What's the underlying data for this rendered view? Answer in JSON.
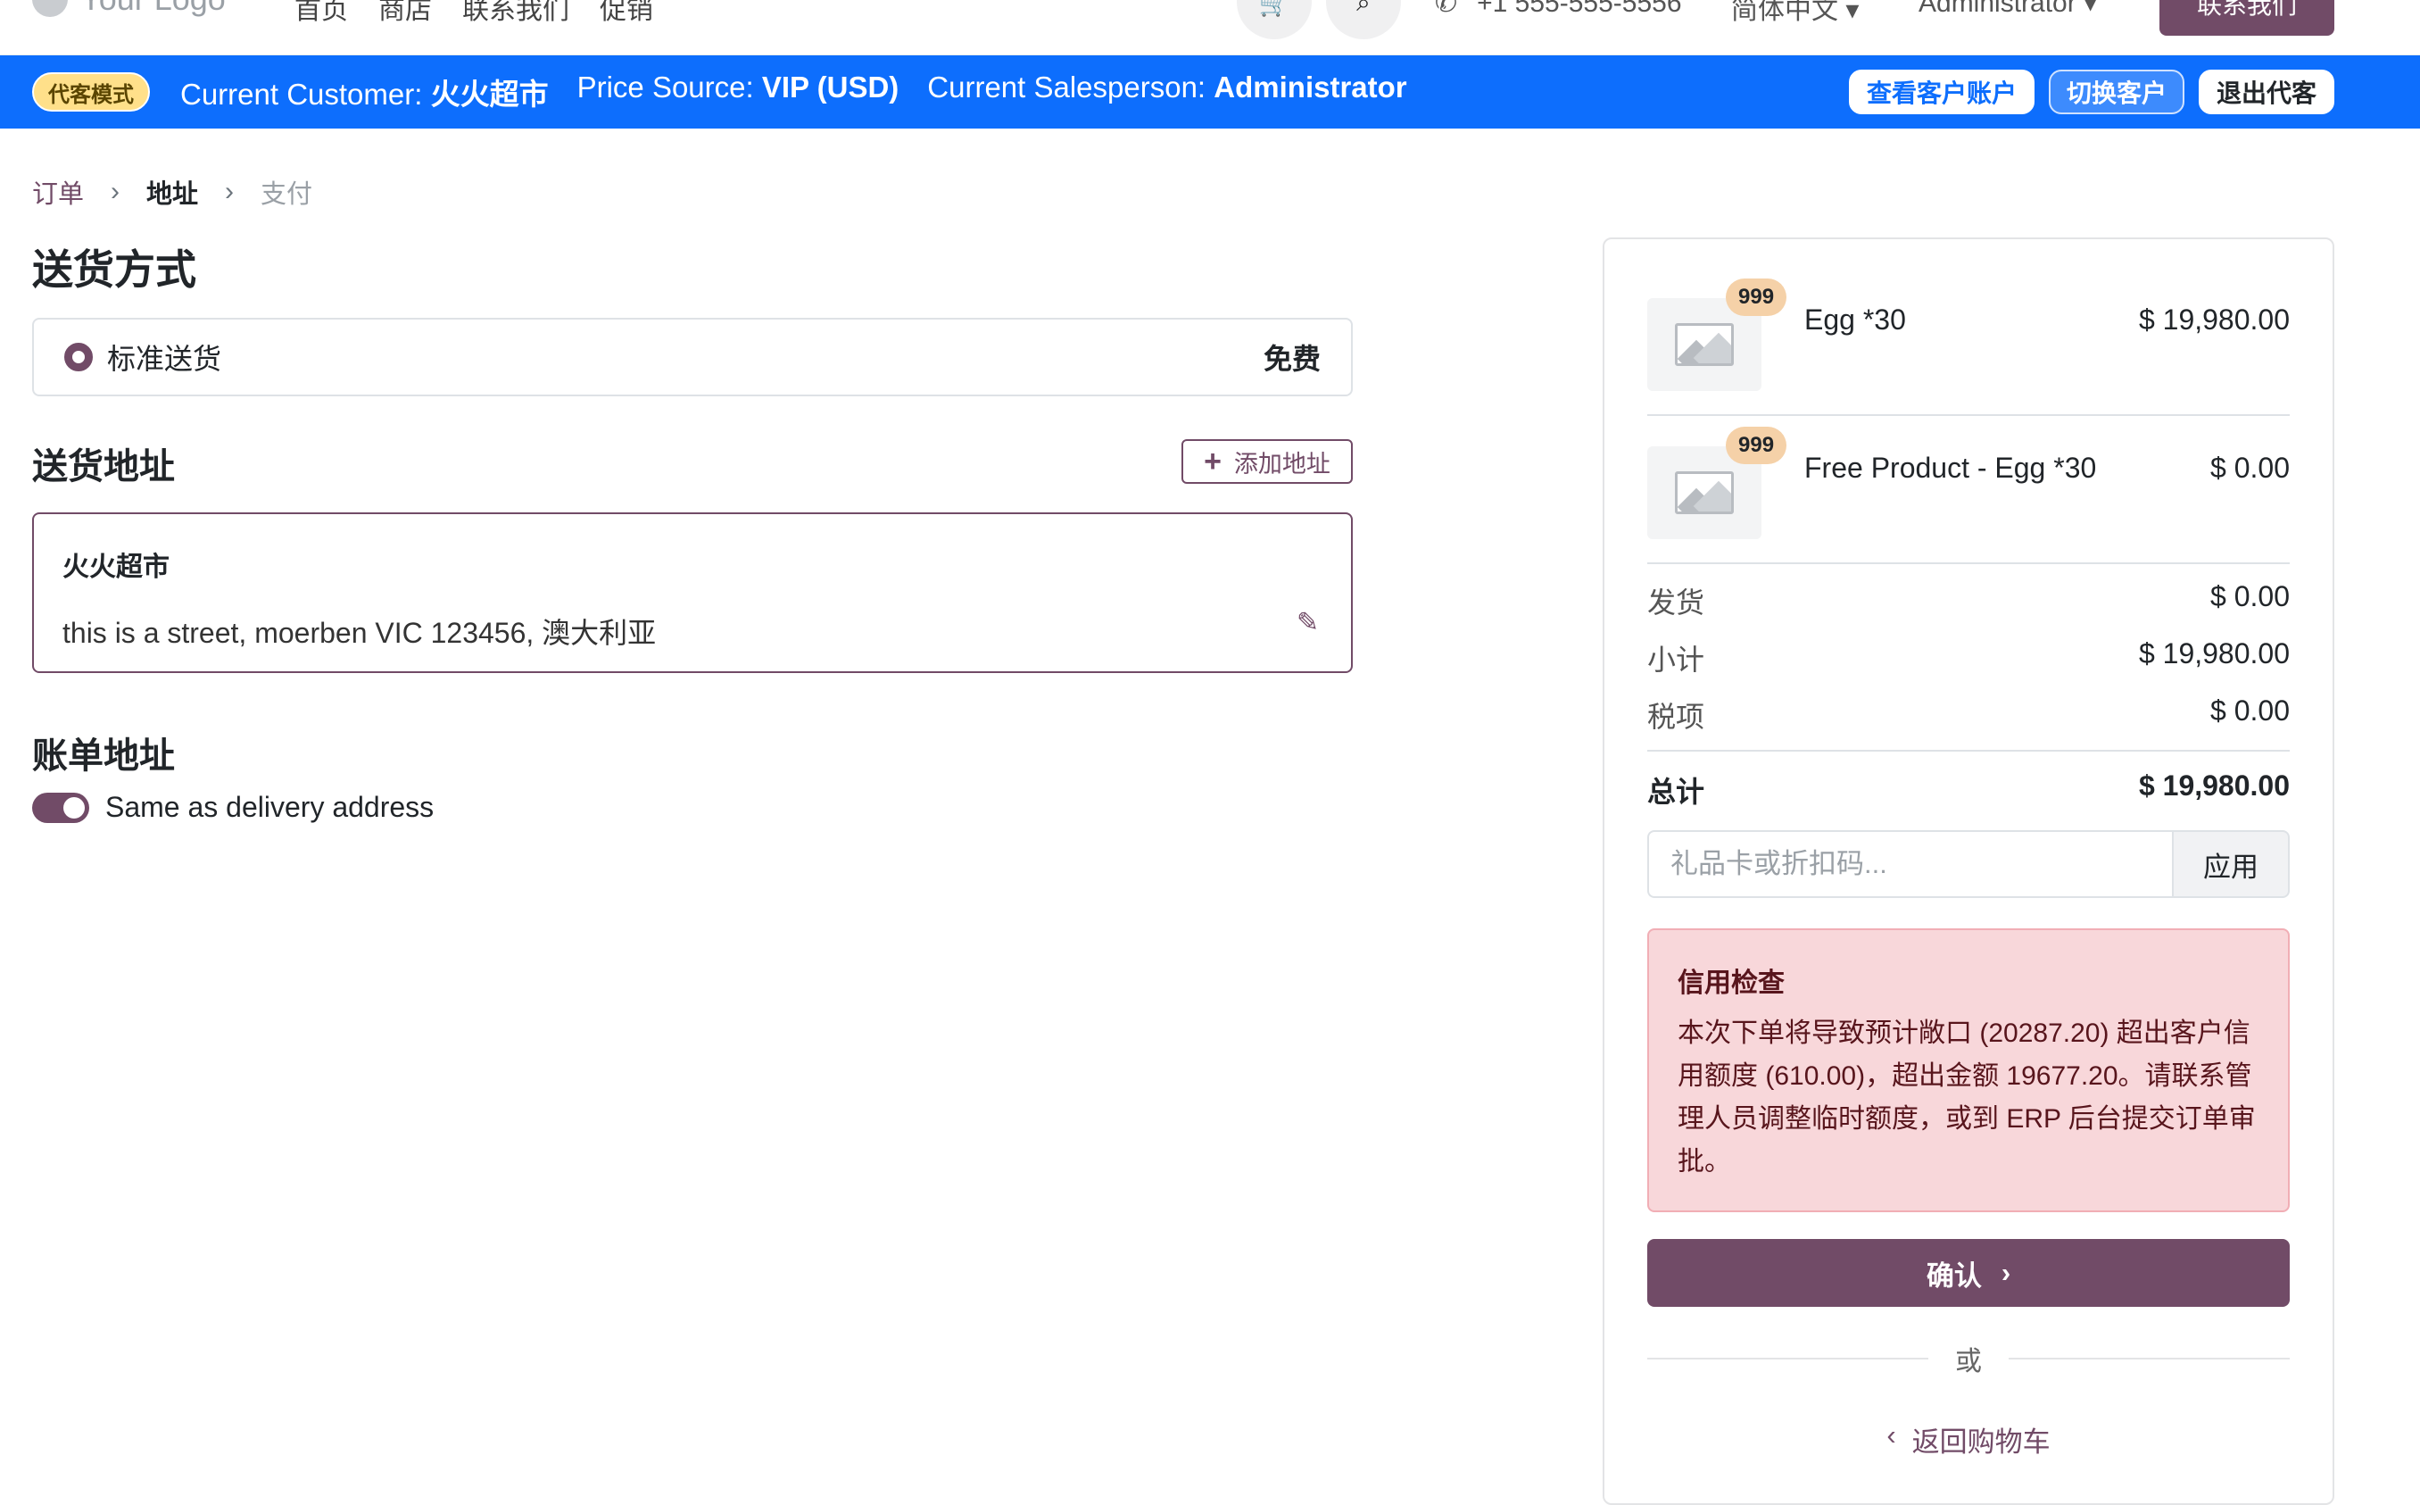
{
  "topnav": {
    "logo_text": "Your Logo",
    "links": [
      "首页",
      "商店",
      "联系我们",
      "促销"
    ],
    "phone": "+1 555-555-5556",
    "language": "简体中文",
    "user": "Administrator",
    "contact_button": "联系我们"
  },
  "agent_bar": {
    "badge": "代客模式",
    "customer_label": "Current Customer:",
    "customer_value": "火火超市",
    "price_label": "Price Source:",
    "price_value": "VIP (USD)",
    "salesperson_label": "Current Salesperson:",
    "salesperson_value": "Administrator",
    "actions": [
      "查看客户账户",
      "切换客户",
      "退出代客"
    ]
  },
  "breadcrumb": [
    "订单",
    "地址",
    "支付"
  ],
  "delivery": {
    "title": "送货方式",
    "method_name": "标准送货",
    "method_price": "免费"
  },
  "shipping_address": {
    "title": "送货地址",
    "add_button": "添加地址",
    "name": "火火超市",
    "line": "this is a street, moerben VIC 123456, 澳大利亚"
  },
  "billing": {
    "title": "账单地址",
    "same_as_delivery_label": "Same as delivery address",
    "same_as_delivery": true
  },
  "summary": {
    "items": [
      {
        "qty": "999",
        "name": "Egg *30",
        "price": "$ 19,980.00"
      },
      {
        "qty": "999",
        "name": "Free Product - Egg *30",
        "price": "$ 0.00"
      }
    ],
    "rows": [
      {
        "label": "发货",
        "value": "$ 0.00"
      },
      {
        "label": "小计",
        "value": "$ 19,980.00"
      },
      {
        "label": "税项",
        "value": "$ 0.00"
      }
    ],
    "total_label": "总计",
    "total_value": "$ 19,980.00",
    "coupon_placeholder": "礼品卡或折扣码...",
    "apply_button": "应用",
    "alert_title": "信用检查",
    "alert_body": "本次下单将导致预计敞口 (20287.20) 超出客户信用额度 (610.00)，超出金额 19677.20。请联系管理人员调整临时额度，或到 ERP 后台提交订单审批。",
    "confirm_button": "确认",
    "or_text": "或",
    "back_link": "返回购物车"
  },
  "colors": {
    "brand": "#714b67",
    "agent_bar": "#0d6efd",
    "alert_bg": "#f8d7da"
  }
}
